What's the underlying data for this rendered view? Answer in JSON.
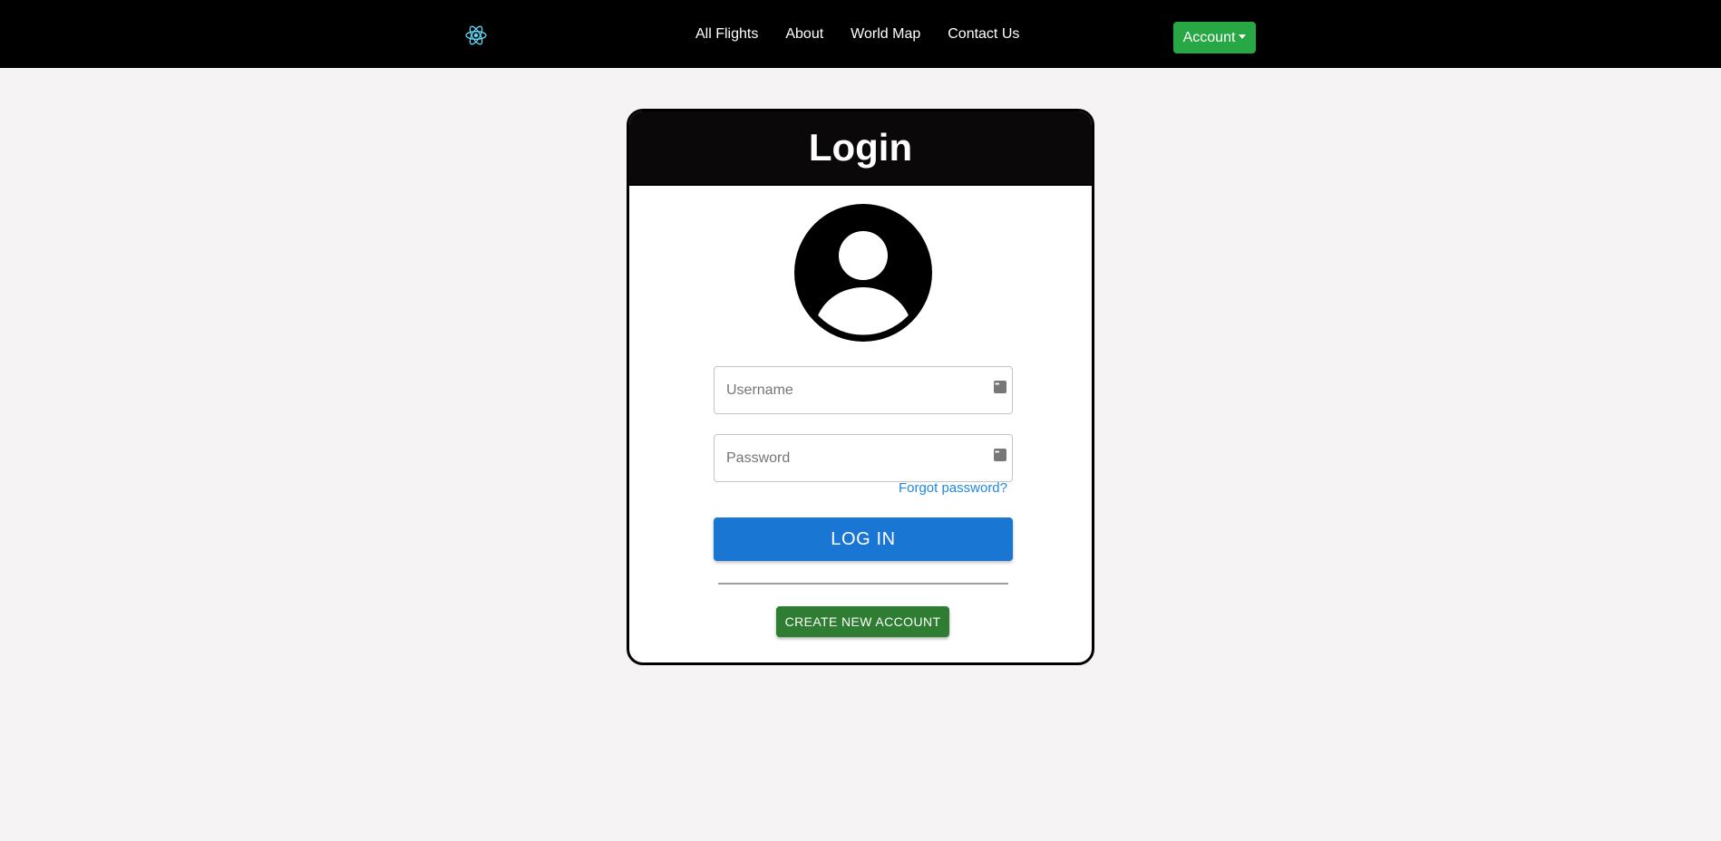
{
  "navbar": {
    "logo_icon": "react-atom-icon",
    "links": [
      {
        "label": "All Flights"
      },
      {
        "label": "About"
      },
      {
        "label": "World Map"
      },
      {
        "label": "Contact Us"
      }
    ],
    "account_label": "Account",
    "account_color": "#28a745"
  },
  "login": {
    "title": "Login",
    "avatar_icon": "user-circle-icon",
    "username_placeholder": "Username",
    "password_placeholder": "Password",
    "field_icon": "password-manager-icon",
    "forgot_label": "Forgot password?",
    "login_button": "LOG IN",
    "login_button_color": "#1976d2",
    "create_button": "CREATE NEW ACCOUNT",
    "create_button_color": "#2e7d32"
  }
}
